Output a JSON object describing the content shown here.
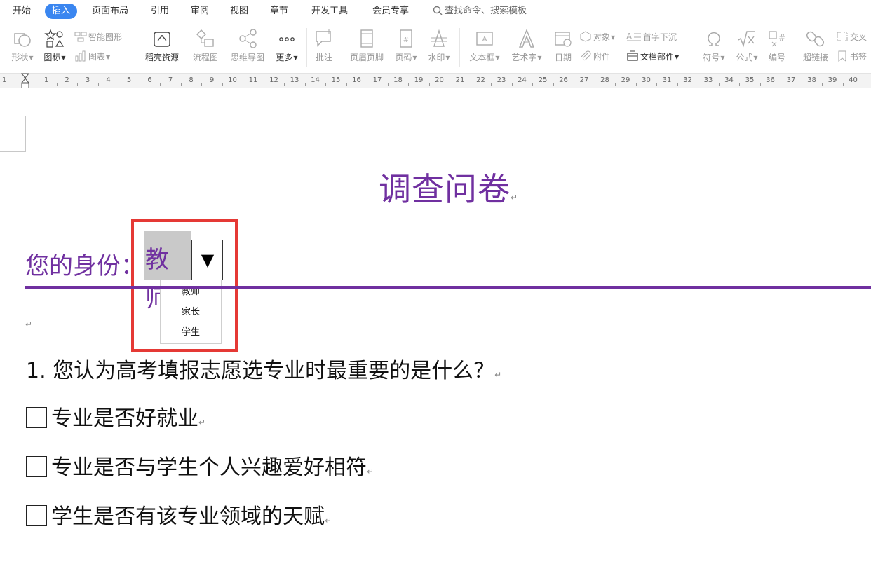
{
  "menu": {
    "tabs": [
      "开始",
      "插入",
      "页面布局",
      "引用",
      "审阅",
      "视图",
      "章节",
      "开发工具",
      "会员专享"
    ],
    "active_tab": "插入",
    "search_label": "查找命令、搜索模板"
  },
  "toolbar": {
    "shape": "形状",
    "icons": "图标",
    "smart_graphic": "智能图形",
    "chart": "图表",
    "daoke": "稻壳资源",
    "flowchart": "流程图",
    "mindmap": "思维导图",
    "more": "更多",
    "comment": "批注",
    "header_footer": "页眉页脚",
    "page_number": "页码",
    "watermark": "水印",
    "textbox": "文本框",
    "wordart": "艺术字",
    "date": "日期",
    "object": "对象",
    "dropcap": "首字下沉",
    "attachment": "附件",
    "doc_parts": "文档部件",
    "symbol": "符号",
    "formula": "公式",
    "numbering": "编号",
    "hyperlink": "超链接",
    "crossref": "交叉",
    "bookmark": "书签"
  },
  "ruler": {
    "labels": [
      "1",
      "1",
      "1",
      "2",
      "3",
      "4",
      "5",
      "6",
      "7",
      "8",
      "9",
      "10",
      "11",
      "12",
      "13",
      "14",
      "15",
      "16",
      "17",
      "18",
      "19",
      "20",
      "21",
      "22",
      "23",
      "24",
      "25",
      "26",
      "27",
      "28",
      "29",
      "30",
      "31",
      "32",
      "33",
      "34",
      "35",
      "36",
      "37",
      "38",
      "39",
      "40"
    ]
  },
  "document": {
    "title": "调查问卷",
    "identity_label": "您的身份：",
    "identity_value": "教师",
    "dropdown_arrow": "▼",
    "dropdown_options": [
      "教师",
      "家长",
      "学生"
    ],
    "question": "1. 您认为高考填报志愿选专业时最重要的是什么？",
    "options": [
      "专业是否好就业",
      "专业是否与学生个人兴趣爱好相符",
      "学生是否有该专业领域的天赋"
    ],
    "paragraph_mark": "↵"
  },
  "colors": {
    "accent": "#7030a0",
    "active_tab": "#3a86f0",
    "highlight": "#e53935"
  }
}
